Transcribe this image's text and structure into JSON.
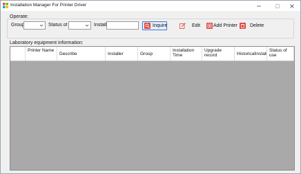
{
  "window": {
    "title": "Installation Manager For Printer Driver"
  },
  "operate": {
    "label": "Operate:",
    "group_label": "Group",
    "group_value": "",
    "status_label": "Status of u",
    "status_value": "",
    "installer_label": "Installe",
    "installer_value": "",
    "inquire_label": "Inquire",
    "edit_label": "Edit",
    "add_label": "Add Printer",
    "delete_label": "Delete"
  },
  "grid": {
    "label": "Laboratory equipment information:",
    "columns": [
      "Printer Name",
      "Describe",
      "Installer",
      "Group",
      "Installation Time",
      "Upgrade record",
      "HistoricalInstalle",
      "Status of use"
    ]
  },
  "colors": {
    "grid_background": "#a9a9a9",
    "inquire_border": "#3a78d6",
    "icon_red": "#e0463c"
  }
}
